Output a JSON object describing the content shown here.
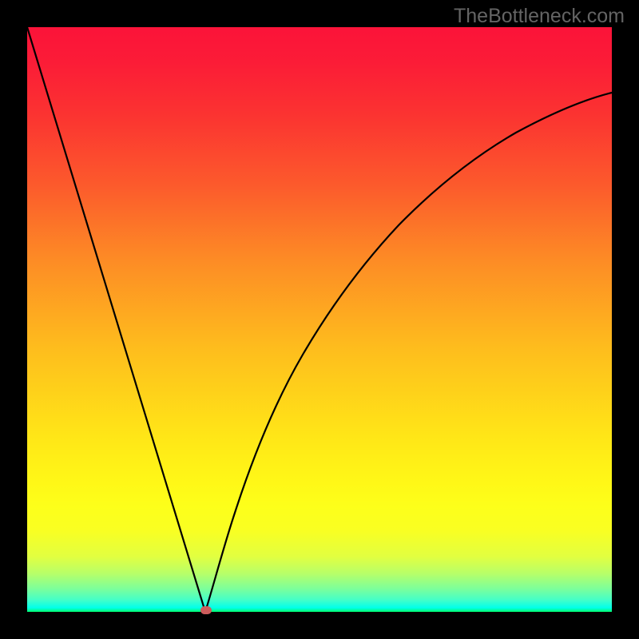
{
  "watermark": "TheBottleneck.com",
  "chart_data": {
    "type": "line",
    "title": "",
    "xlabel": "",
    "ylabel": "",
    "xlim": [
      0,
      1
    ],
    "ylim": [
      0,
      1
    ],
    "x_optimum": 0.305,
    "series": [
      {
        "name": "bottleneck-curve-left",
        "x": [
          0.0,
          0.305
        ],
        "y": [
          1.0,
          0.0
        ],
        "note": "approximately straight descending line from top-left to the minimum"
      },
      {
        "name": "bottleneck-curve-right",
        "x": [
          0.305,
          0.35,
          0.4,
          0.45,
          0.5,
          0.55,
          0.6,
          0.65,
          0.7,
          0.75,
          0.8,
          0.85,
          0.9,
          0.95,
          1.0
        ],
        "y": [
          0.0,
          0.17,
          0.32,
          0.44,
          0.54,
          0.62,
          0.685,
          0.735,
          0.775,
          0.805,
          0.83,
          0.85,
          0.865,
          0.878,
          0.888
        ],
        "note": "concave curve rising from the minimum toward upper-right, tapering"
      }
    ],
    "marker": {
      "x": 0.305,
      "y": 0.0,
      "color": "#cd5c5c",
      "shape": "rounded-rect"
    },
    "gradient_stops": [
      {
        "t": 0.0,
        "color": "#fb1339"
      },
      {
        "t": 0.55,
        "color": "#febd1d"
      },
      {
        "t": 0.82,
        "color": "#fdff1a"
      },
      {
        "t": 1.0,
        "color": "#02ff6e"
      }
    ]
  }
}
